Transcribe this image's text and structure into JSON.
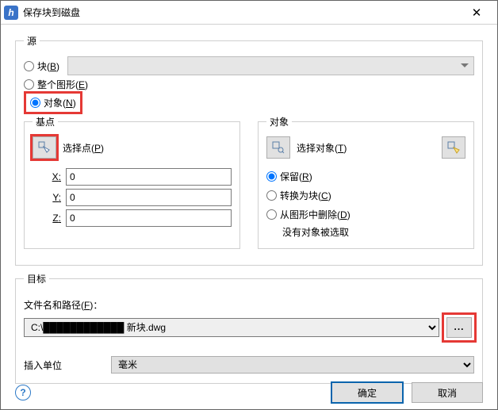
{
  "window": {
    "title": "保存块到磁盘",
    "icon_letter": "h"
  },
  "source": {
    "legend": "源",
    "options": {
      "block": {
        "label": "块",
        "hotkey": "B",
        "checked": false
      },
      "drawing": {
        "label": "整个图形",
        "hotkey": "E",
        "checked": false
      },
      "objects": {
        "label": "对象",
        "hotkey": "N",
        "checked": true
      }
    }
  },
  "base_point": {
    "legend": "基点",
    "pick_label": "选择点",
    "pick_hotkey": "P",
    "x_label": "X",
    "y_label": "Y",
    "z_label": "Z",
    "x": "0",
    "y": "0",
    "z": "0"
  },
  "objects": {
    "legend": "对象",
    "select_label": "选择对象",
    "select_hotkey": "T",
    "retain": {
      "label": "保留",
      "hotkey": "R",
      "checked": true
    },
    "convert": {
      "label": "转换为块",
      "hotkey": "C",
      "checked": false
    },
    "delete": {
      "label": "从图形中删除",
      "hotkey": "D",
      "checked": false
    },
    "none_selected": "没有对象被选取"
  },
  "target": {
    "legend": "目标",
    "path_label": "文件名和路径",
    "path_hotkey": "F",
    "path_value": "C:\\Users\\…\\Documents\\新块.dwg",
    "path_display_prefix": "C:\\",
    "path_display_suffix": "新块.dwg",
    "browse_label": "...",
    "unit_label": "插入单位",
    "unit_value": "毫米"
  },
  "footer": {
    "ok": "确定",
    "cancel": "取消"
  }
}
